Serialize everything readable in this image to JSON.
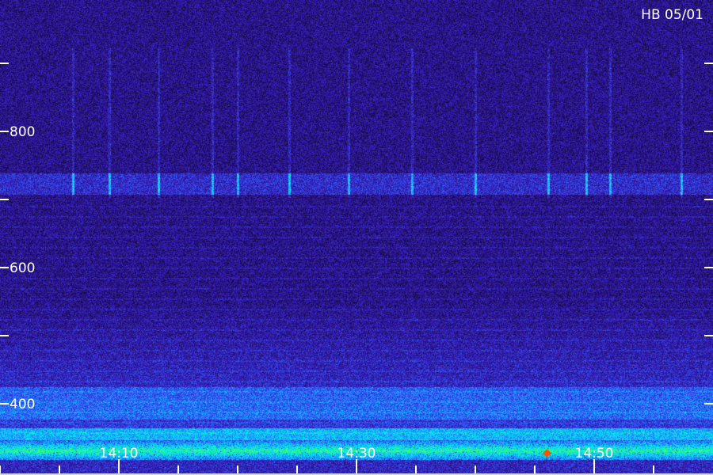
{
  "chart_data": {
    "type": "heatmap",
    "title": "HB 05/01",
    "xlabel": "",
    "ylabel": "",
    "ylim": [
      280,
      1100
    ],
    "y_ticks": [
      {
        "value": 400,
        "label": "400"
      },
      {
        "value": 500,
        "label": ""
      },
      {
        "value": 600,
        "label": "600"
      },
      {
        "value": 700,
        "label": ""
      },
      {
        "value": 800,
        "label": "800"
      },
      {
        "value": 900,
        "label": ""
      }
    ],
    "x_ticks": [
      {
        "value": "14:10",
        "label": "14:10"
      },
      {
        "value": "14:30",
        "label": "14:30"
      },
      {
        "value": "14:50",
        "label": "14:50"
      }
    ],
    "x_minor_ticks": [
      "14:00",
      "14:05",
      "14:15",
      "14:20",
      "14:25",
      "14:35",
      "14:40",
      "14:45",
      "14:55"
    ],
    "x_range": [
      "13:58",
      "15:00"
    ],
    "colormap": [
      "#000000",
      "#1e0f5c",
      "#3a1ec8",
      "#2a70ff",
      "#00e0ff",
      "#33ff66",
      "#ffff00",
      "#ff2000"
    ],
    "grid": false,
    "legend": "none"
  }
}
